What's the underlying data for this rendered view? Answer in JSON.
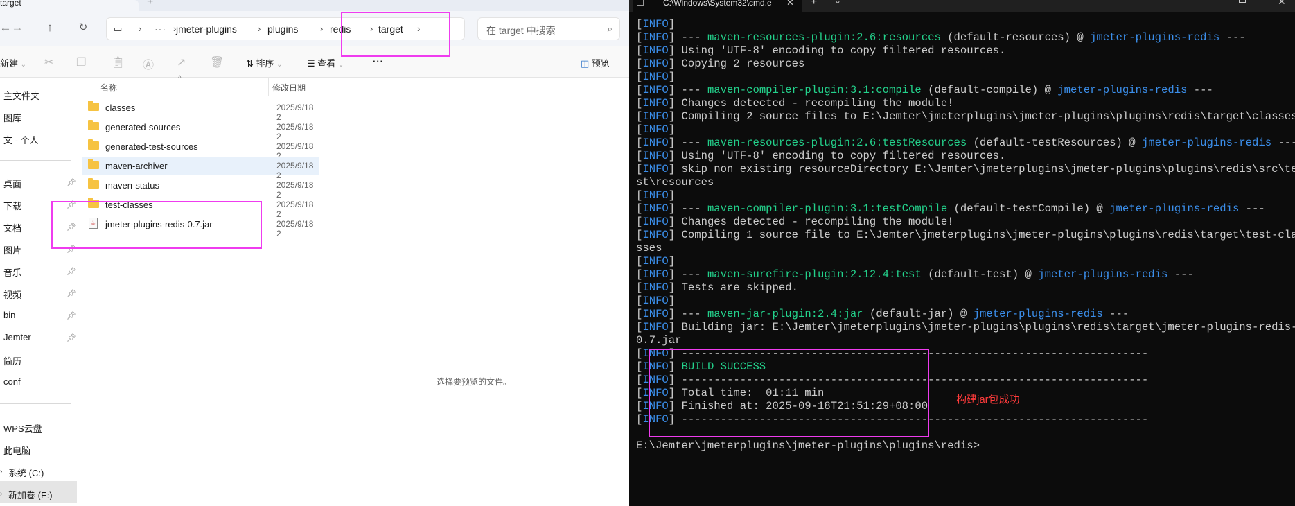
{
  "explorer": {
    "tab_title": "target",
    "breadcrumb": [
      "jmeter-plugins",
      "plugins",
      "redis",
      "target"
    ],
    "search_placeholder": "在 target 中搜索",
    "toolbar": {
      "new_label": "新建",
      "sort_label": "排序",
      "view_label": "查看",
      "more_label": "···",
      "preview_label": "预览"
    },
    "sidebar": {
      "top_items": [
        "主文件夹",
        "图库",
        "文 - 个人"
      ],
      "pinned_items": [
        "桌面",
        "下载",
        "文档",
        "图片",
        "音乐",
        "视频",
        "bin",
        "Jemter",
        "简历",
        "conf"
      ],
      "bottom_items": [
        "WPS云盘",
        "此电脑",
        "系统 (C:)",
        "新加卷 (E:)"
      ]
    },
    "columns": {
      "name": "名称",
      "modified": "修改日期"
    },
    "files": [
      {
        "name": "classes",
        "date": "2025/9/18 2",
        "type": "folder",
        "selected": false
      },
      {
        "name": "generated-sources",
        "date": "2025/9/18 2",
        "type": "folder",
        "selected": false
      },
      {
        "name": "generated-test-sources",
        "date": "2025/9/18 2",
        "type": "folder",
        "selected": false
      },
      {
        "name": "maven-archiver",
        "date": "2025/9/18 2",
        "type": "folder",
        "selected": true
      },
      {
        "name": "maven-status",
        "date": "2025/9/18 2",
        "type": "folder",
        "selected": false
      },
      {
        "name": "test-classes",
        "date": "2025/9/18 2",
        "type": "folder",
        "selected": false
      },
      {
        "name": "jmeter-plugins-redis-0.7.jar",
        "date": "2025/9/18 2",
        "type": "jar",
        "selected": false
      }
    ],
    "preview_text": "选择要预览的文件。"
  },
  "terminal": {
    "tab_title": "C:\\Windows\\System32\\cmd.e",
    "lines": [
      [
        "[",
        "INFO",
        "]"
      ],
      [
        "[",
        "INFO",
        "] --- ",
        "maven-resources-plugin:2.6:resources",
        " (default-resources) @ ",
        "jmeter-plugins-redis",
        " ---"
      ],
      [
        "[",
        "INFO",
        "] Using 'UTF-8' encoding to copy filtered resources."
      ],
      [
        "[",
        "INFO",
        "] Copying 2 resources"
      ],
      [
        "[",
        "INFO",
        "]"
      ],
      [
        "[",
        "INFO",
        "] --- ",
        "maven-compiler-plugin:3.1:compile",
        " (default-compile) @ ",
        "jmeter-plugins-redis",
        " ---"
      ],
      [
        "[",
        "INFO",
        "] Changes detected - recompiling the module!"
      ],
      [
        "[",
        "INFO",
        "] Compiling 2 source files to E:\\Jemter\\jmeterplugins\\jmeter-plugins\\plugins\\redis\\target\\classes"
      ],
      [
        "[",
        "INFO",
        "]"
      ],
      [
        "[",
        "INFO",
        "] --- ",
        "maven-resources-plugin:2.6:testResources",
        " (default-testResources) @ ",
        "jmeter-plugins-redis",
        " ---"
      ],
      [
        "[",
        "INFO",
        "] Using 'UTF-8' encoding to copy filtered resources."
      ],
      [
        "[",
        "INFO",
        "] skip non existing resourceDirectory E:\\Jemter\\jmeterplugins\\jmeter-plugins\\plugins\\redis\\src\\te"
      ],
      [
        "st\\resources"
      ],
      [
        "[",
        "INFO",
        "]"
      ],
      [
        "[",
        "INFO",
        "] --- ",
        "maven-compiler-plugin:3.1:testCompile",
        " (default-testCompile) @ ",
        "jmeter-plugins-redis",
        " ---"
      ],
      [
        "[",
        "INFO",
        "] Changes detected - recompiling the module!"
      ],
      [
        "[",
        "INFO",
        "] Compiling 1 source file to E:\\Jemter\\jmeterplugins\\jmeter-plugins\\plugins\\redis\\target\\test-cla"
      ],
      [
        "sses"
      ],
      [
        "[",
        "INFO",
        "]"
      ],
      [
        "[",
        "INFO",
        "] --- ",
        "maven-surefire-plugin:2.12.4:test",
        " (default-test) @ ",
        "jmeter-plugins-redis",
        " ---"
      ],
      [
        "[",
        "INFO",
        "] Tests are skipped."
      ],
      [
        "[",
        "INFO",
        "]"
      ],
      [
        "[",
        "INFO",
        "] --- ",
        "maven-jar-plugin:2.4:jar",
        " (default-jar) @ ",
        "jmeter-plugins-redis",
        " ---"
      ],
      [
        "[",
        "INFO",
        "] Building jar: E:\\Jemter\\jmeterplugins\\jmeter-plugins\\plugins\\redis\\target\\jmeter-plugins-redis-"
      ],
      [
        "0.7.jar"
      ],
      [
        "[",
        "INFO",
        "] ------------------------------------------------------------------------"
      ],
      [
        "[",
        "INFO",
        "] ",
        "BUILD SUCCESS"
      ],
      [
        "[",
        "INFO",
        "] ------------------------------------------------------------------------"
      ],
      [
        "[",
        "INFO",
        "] Total time:  01:11 min"
      ],
      [
        "[",
        "INFO",
        "] Finished at: 2025-09-18T21:51:29+08:00"
      ],
      [
        "[",
        "INFO",
        "] ------------------------------------------------------------------------"
      ],
      [
        ""
      ],
      [
        "E:\\Jemter\\jmeterplugins\\jmeter-plugins\\plugins\\redis>"
      ]
    ]
  },
  "annotation": {
    "text": "构建jar包成功",
    "color": "#ff3b3b"
  },
  "colors": {
    "highlight_box": "#ef3cef",
    "info": "#3b8eea",
    "plugin": "#23d18b",
    "artifact": "#3b8eea",
    "success": "#23d18b"
  }
}
